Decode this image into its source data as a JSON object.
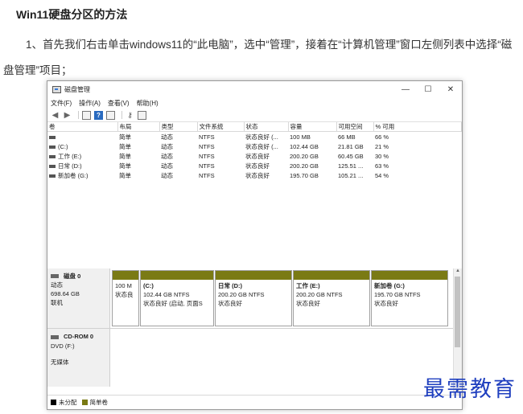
{
  "article": {
    "title": "Win11硬盘分区的方法",
    "paragraph": "1、首先我们右击单击windows11的“此电脑”，选中“管理”，接着在“计算机管理”窗口左侧列表中选择“磁盘管理”项目；"
  },
  "window": {
    "title": "磁盘管理",
    "controls": {
      "minimize": "—",
      "maximize": "☐",
      "close": "✕"
    },
    "menu": [
      "文件(F)",
      "操作(A)",
      "查看(V)",
      "帮助(H)"
    ],
    "toolbar_icons": [
      "back-arrow-icon",
      "forward-arrow-icon",
      "list-view-icon",
      "help-icon",
      "properties-icon",
      "key-icon",
      "console-icon"
    ]
  },
  "volumes": {
    "columns": [
      "卷",
      "布局",
      "类型",
      "文件系统",
      "状态",
      "容量",
      "可用空间",
      "% 可用"
    ],
    "rows": [
      [
        "",
        "简单",
        "动态",
        "NTFS",
        "状态良好 (...",
        "100 MB",
        "66 MB",
        "66 %"
      ],
      [
        "(C:)",
        "简单",
        "动态",
        "NTFS",
        "状态良好 (...",
        "102.44 GB",
        "21.81 GB",
        "21 %"
      ],
      [
        "工作 (E:)",
        "简单",
        "动态",
        "NTFS",
        "状态良好",
        "200.20 GB",
        "60.45 GB",
        "30 %"
      ],
      [
        "日常 (D:)",
        "简单",
        "动态",
        "NTFS",
        "状态良好",
        "200.20 GB",
        "125.51 ...",
        "63 %"
      ],
      [
        "新加卷 (G:)",
        "简单",
        "动态",
        "NTFS",
        "状态良好",
        "195.70 GB",
        "105.21 ...",
        "54 %"
      ]
    ]
  },
  "disk0": {
    "name": "磁盘 0",
    "type": "动态",
    "size": "698.64 GB",
    "status": "联机",
    "partitions": [
      {
        "name": "",
        "size": "100 M",
        "status": "状态良"
      },
      {
        "name": "(C:)",
        "size": "102.44 GB NTFS",
        "status": "状态良好 (启动, 页面S"
      },
      {
        "name": "日常 (D:)",
        "size": "200.20 GB NTFS",
        "status": "状态良好"
      },
      {
        "name": "工作 (E:)",
        "size": "200.20 GB NTFS",
        "status": "状态良好"
      },
      {
        "name": "新加卷 (G:)",
        "size": "195.70 GB NTFS",
        "status": "状态良好"
      }
    ]
  },
  "cdrom0": {
    "name": "CD-ROM 0",
    "drive": "DVD (F:)",
    "media": "无媒体"
  },
  "legend": {
    "unallocated": "未分配",
    "simple": "简单卷",
    "unallocated_color": "#000000",
    "simple_color": "#7a7a14"
  },
  "watermark": "最需教育"
}
